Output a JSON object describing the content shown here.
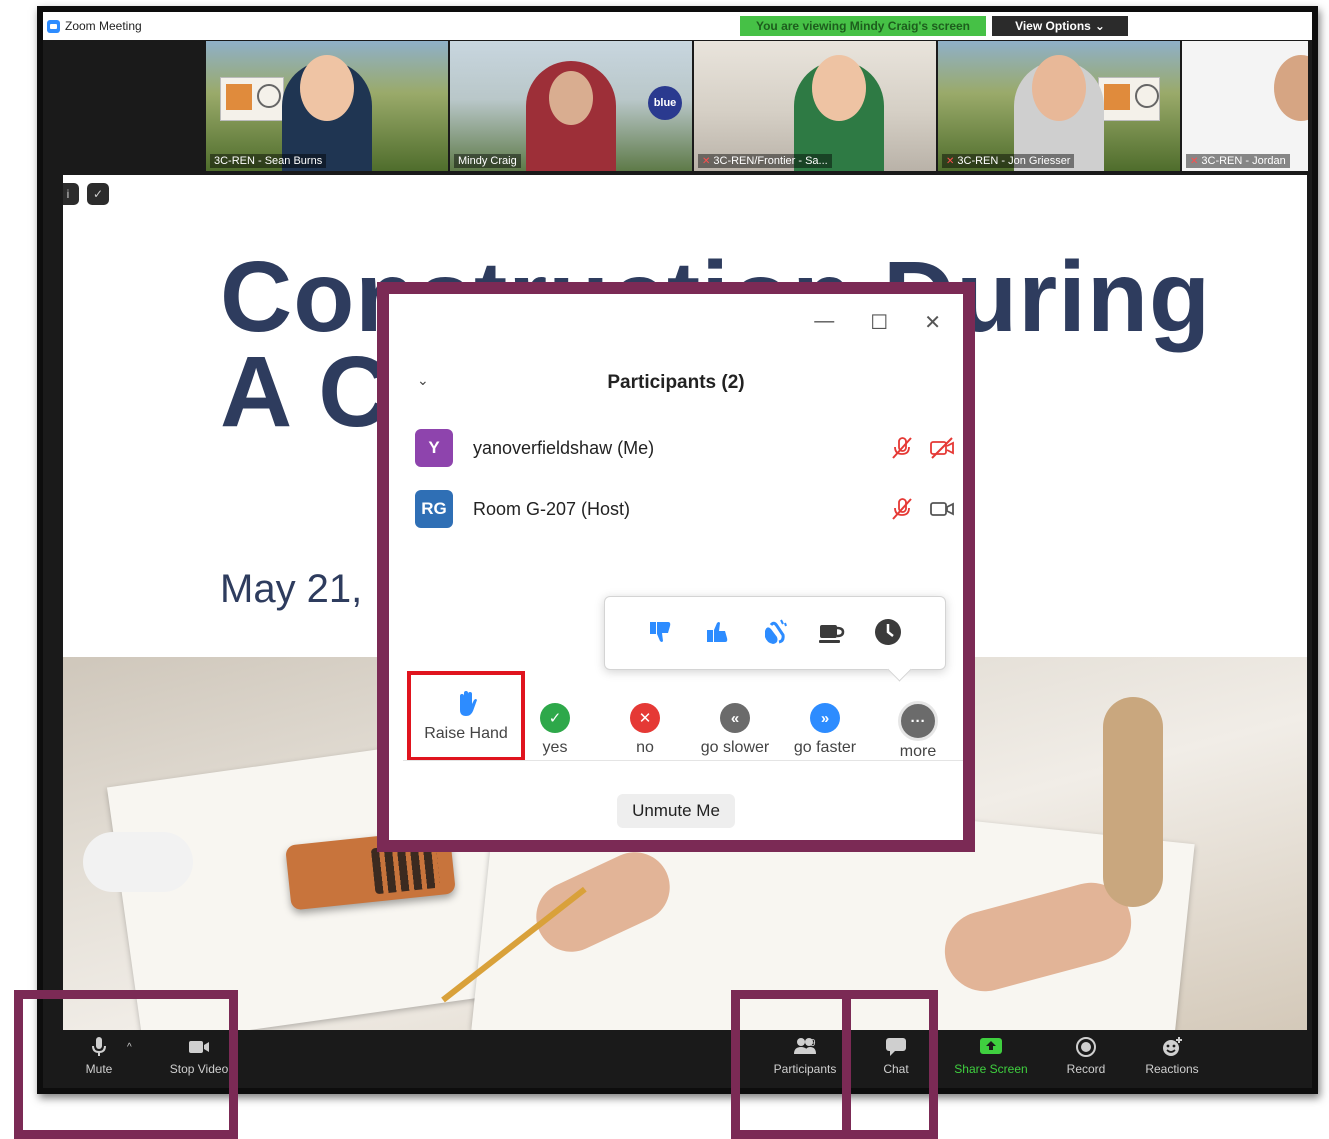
{
  "window": {
    "title": "Zoom Meeting",
    "viewing_banner": "You are viewing Mindy Craig's screen",
    "view_options": "View Options"
  },
  "video_tiles": [
    {
      "name": "3C-REN - Sean Burns",
      "muted": false
    },
    {
      "name": "Mindy Craig",
      "muted": false
    },
    {
      "name": "3C-REN/Frontier - Sa...",
      "muted": true
    },
    {
      "name": "3C-REN - Jon Griesser",
      "muted": true
    },
    {
      "name": "3C-REN - Jordan",
      "muted": true
    }
  ],
  "slide": {
    "title": "Construction During\nA C",
    "date": "May 21,"
  },
  "participants_panel": {
    "header": "Participants (2)",
    "participants": [
      {
        "initials": "Y",
        "name": "yanoverfieldshaw (Me)",
        "avatar_color": "#8e44ad",
        "audio": "muted",
        "video": "off"
      },
      {
        "initials": "RG",
        "name": "Room G-207 (Host)",
        "avatar_color": "#2f6fb5",
        "audio": "muted",
        "video": "on"
      }
    ],
    "reactions": [
      "thumbs-down-icon",
      "thumbs-up-icon",
      "clap-icon",
      "coffee-icon",
      "clock-icon"
    ],
    "feedback": {
      "raise_hand": "Raise Hand",
      "yes": "yes",
      "no": "no",
      "go_slower": "go slower",
      "go_faster": "go faster",
      "more": "more"
    },
    "unmute_label": "Unmute Me"
  },
  "toolbar": {
    "mute": "Mute",
    "stop_video": "Stop Video",
    "participants": "Participants",
    "participant_count": "9",
    "chat": "Chat",
    "share_screen": "Share Screen",
    "record": "Record",
    "reactions": "Reactions"
  },
  "colors": {
    "annotation_frame": "#7b2a55",
    "highlight": "#e0141e",
    "zoom_blue": "#2d8cff",
    "share_green": "#3fcf3f"
  }
}
